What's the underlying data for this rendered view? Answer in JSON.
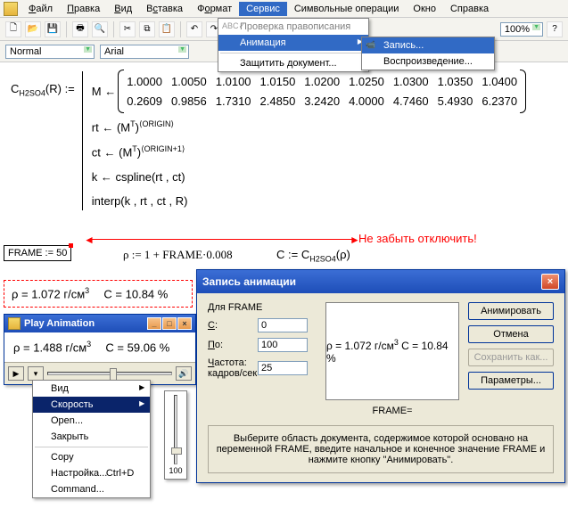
{
  "menubar": {
    "items": [
      "Файл",
      "Правка",
      "Вид",
      "Вставка",
      "Формат",
      "Сервис",
      "Символьные операции",
      "Окно",
      "Справка"
    ],
    "active_index": 5
  },
  "toolbar": {
    "zoom": "100%"
  },
  "fmtbar": {
    "style": "Normal",
    "font": "Arial"
  },
  "service_menu": {
    "items": [
      {
        "label": "Проверка правописания",
        "enabled": false,
        "abc": true
      },
      {
        "label": "Анимация",
        "enabled": true,
        "hl": true,
        "arrow": true
      },
      {
        "label": "Защитить документ...",
        "enabled": true
      }
    ]
  },
  "anim_submenu": {
    "items": [
      {
        "label": "Запись...",
        "hl": true,
        "cam": true
      },
      {
        "label": "Воспроизведение..."
      }
    ]
  },
  "doc": {
    "func_name": "C",
    "func_sub": "H2SO4",
    "func_arg": "(R) :=",
    "m_lhs": "M ←",
    "matrix": [
      [
        "1.0000",
        "1.0050",
        "1.0100",
        "1.0150",
        "1.0200",
        "1.0250",
        "1.0300",
        "1.0350",
        "1.0400"
      ],
      [
        "0.2609",
        "0.9856",
        "1.7310",
        "2.4850",
        "3.2420",
        "4.0000",
        "4.7460",
        "5.4930",
        "6.2370"
      ]
    ],
    "rt": "rt ← (M",
    "rt_sup": "T",
    "rt_tail": ")",
    "rt_idx": "⟨ORIGIN⟩",
    "ct": "ct ← (M",
    "ct_sup": "T",
    "ct_tail": ")",
    "ct_idx": "⟨ORIGIN+1⟩",
    "k": "k ← cspline(rt , ct)",
    "interp": "interp(k , rt , ct , R)",
    "frame": "FRAME := 50",
    "rho_def": "ρ := 1 + FRAME·0.008",
    "c_def_l": "C := C",
    "c_def_sub": "H2SO4",
    "c_def_r": "(ρ)",
    "result_rho": "ρ = 1.072 г/см",
    "result_rho_sup": "3",
    "result_c": "C = 10.84 %",
    "note": "Не забыть отключить!"
  },
  "play": {
    "title": "Play Animation",
    "rho": "ρ = 1.488 г/см",
    "rho_sup": "3",
    "c": "C = 59.06 %"
  },
  "ctx": {
    "items": [
      {
        "label": "Вид",
        "arrow": true
      },
      {
        "label": "Скорость",
        "arrow": true,
        "hl": true
      },
      {
        "label": "Open..."
      },
      {
        "label": "Закрыть"
      },
      {
        "sep": true
      },
      {
        "label": "Copy"
      },
      {
        "label": "Настройка...",
        "sc": "Ctrl+D"
      },
      {
        "label": "Command..."
      }
    ],
    "speed_val": "100"
  },
  "dlg": {
    "title": "Запись анимации",
    "group": "Для FRAME",
    "from_lbl": "С:",
    "from": "0",
    "to_lbl": "По:",
    "to": "100",
    "fps_lbl": "Частота: кадров/сек",
    "fps": "25",
    "preview_rho": "ρ = 1.072 г/см",
    "preview_rho_sup": "3",
    "preview_c": " C = 10.84 %",
    "fcaption": "FRAME=",
    "buttons": {
      "anim": "Анимировать",
      "cancel": "Отмена",
      "save": "Сохранить как...",
      "opts": "Параметры..."
    },
    "hint": "Выберите область документа, содержимое которой основано на переменной FRAME, введите начальное и конечное значение FRAME и нажмите кнопку \"Анимировать\"."
  }
}
